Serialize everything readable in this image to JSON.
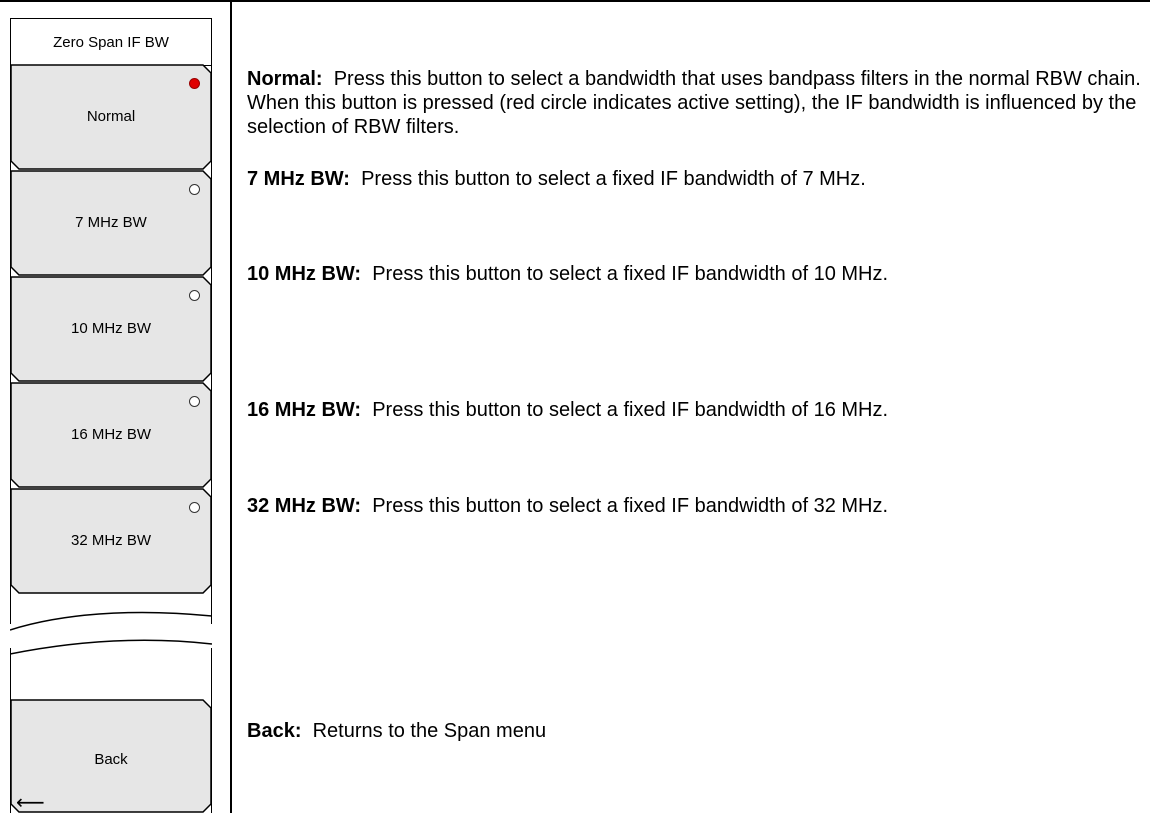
{
  "menu": {
    "title": "Zero Span IF BW",
    "buttons": [
      {
        "label": "Normal",
        "active": true
      },
      {
        "label": "7 MHz BW",
        "active": false
      },
      {
        "label": "10 MHz BW",
        "active": false
      },
      {
        "label": "16 MHz BW",
        "active": false
      },
      {
        "label": "32 MHz BW",
        "active": false
      }
    ],
    "back": {
      "label": "Back",
      "arrow_icon": "left-arrow-icon"
    }
  },
  "descriptions": [
    {
      "term": "Normal:",
      "text": "Press this button to select a bandwidth that uses bandpass filters in the normal RBW chain. When this button is pressed (red circle indicates active setting), the IF bandwidth is influenced by the selection of RBW filters."
    },
    {
      "term": "7 MHz BW:",
      "text": "Press this button to select a fixed IF bandwidth of 7 MHz."
    },
    {
      "term": "10 MHz BW:",
      "text": "Press this button to select a fixed IF bandwidth of 10 MHz."
    },
    {
      "term": "16 MHz BW:",
      "text": "Press this button to select a fixed IF bandwidth of 16 MHz."
    },
    {
      "term": "32 MHz BW:",
      "text": "Press this button to select a fixed IF bandwidth of 32 MHz."
    },
    {
      "term": "Back:",
      "text": "Returns to the Span menu"
    }
  ],
  "colors": {
    "button_fill": "#e6e6e6",
    "active_indicator": "#e00000",
    "border": "#000000"
  }
}
